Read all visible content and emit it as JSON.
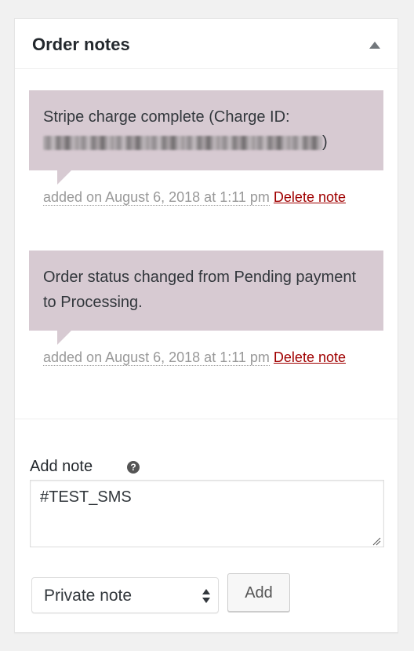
{
  "panel": {
    "title": "Order notes",
    "toggle_icon": "triangle-up-icon"
  },
  "notes": [
    {
      "content_prefix": "Stripe charge complete (Charge ID:",
      "content_suffix": ")",
      "meta_date": "added on August 6, 2018 at 1:11 pm",
      "delete_label": "Delete note"
    },
    {
      "content": "Order status changed from Pending payment to Processing.",
      "meta_date": "added on August 6, 2018 at 1:11 pm",
      "delete_label": "Delete note"
    }
  ],
  "add_note": {
    "label": "Add note",
    "help_icon": "help-icon",
    "textarea_value": "#TEST_SMS",
    "note_type_selected": "Private note",
    "add_button_label": "Add"
  },
  "colors": {
    "note_background": "#d7cad2",
    "delete_link": "#a00000",
    "meta_text": "#999999"
  }
}
